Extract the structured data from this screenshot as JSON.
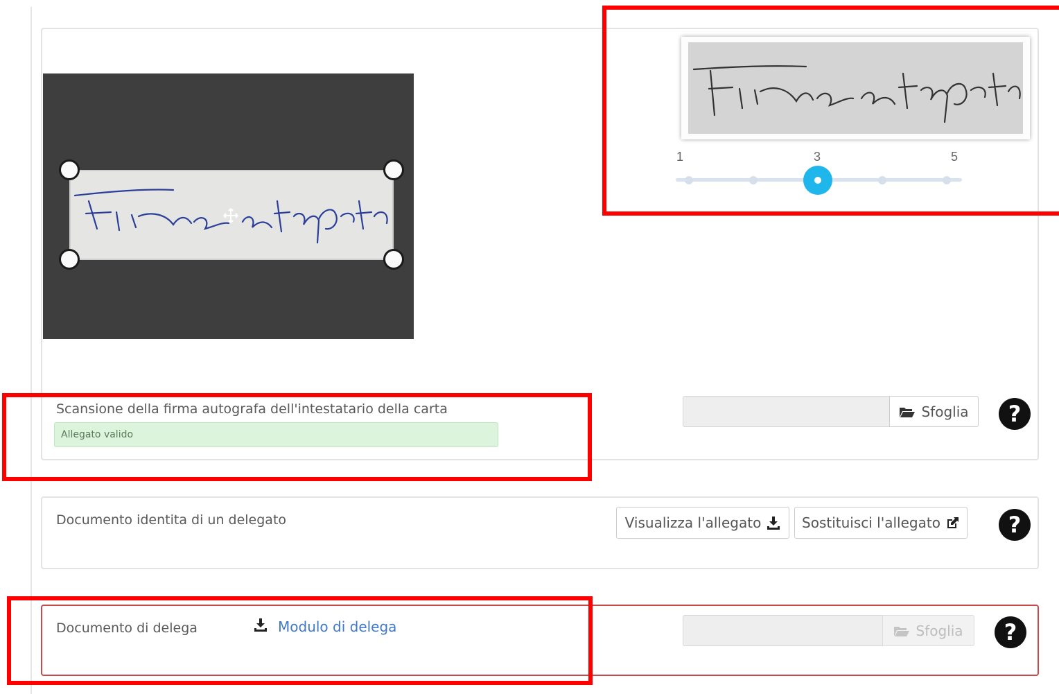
{
  "signature": {
    "handwritten_text": "Firma autografa",
    "slider": {
      "labels": [
        "1",
        "3",
        "5"
      ],
      "min": 1,
      "max": 5,
      "value": 3,
      "steps": 5
    }
  },
  "scan_row": {
    "label": "Scansione della firma autografa dell'intestatario della carta",
    "status": "Allegato valido",
    "browse_label": "Sfoglia",
    "help": "?"
  },
  "delegate_row": {
    "label": "Documento identita di un delegato",
    "view_label": "Visualizza l'allegato",
    "replace_label": "Sostituisci l'allegato",
    "help": "?"
  },
  "delega_row": {
    "label": "Documento di delega",
    "download_link": "Modulo di delega",
    "browse_label": "Sfoglia",
    "help": "?"
  },
  "colors": {
    "accent": "#1fb6ec",
    "highlight": "#ff0000",
    "valid_bg": "#dcf3dc",
    "link": "#3f79c7",
    "error_border": "#c94a4a"
  },
  "icons": {
    "browse": "folder-open-icon",
    "download": "download-icon",
    "replace": "edit-icon",
    "help": "question-circle-icon"
  }
}
